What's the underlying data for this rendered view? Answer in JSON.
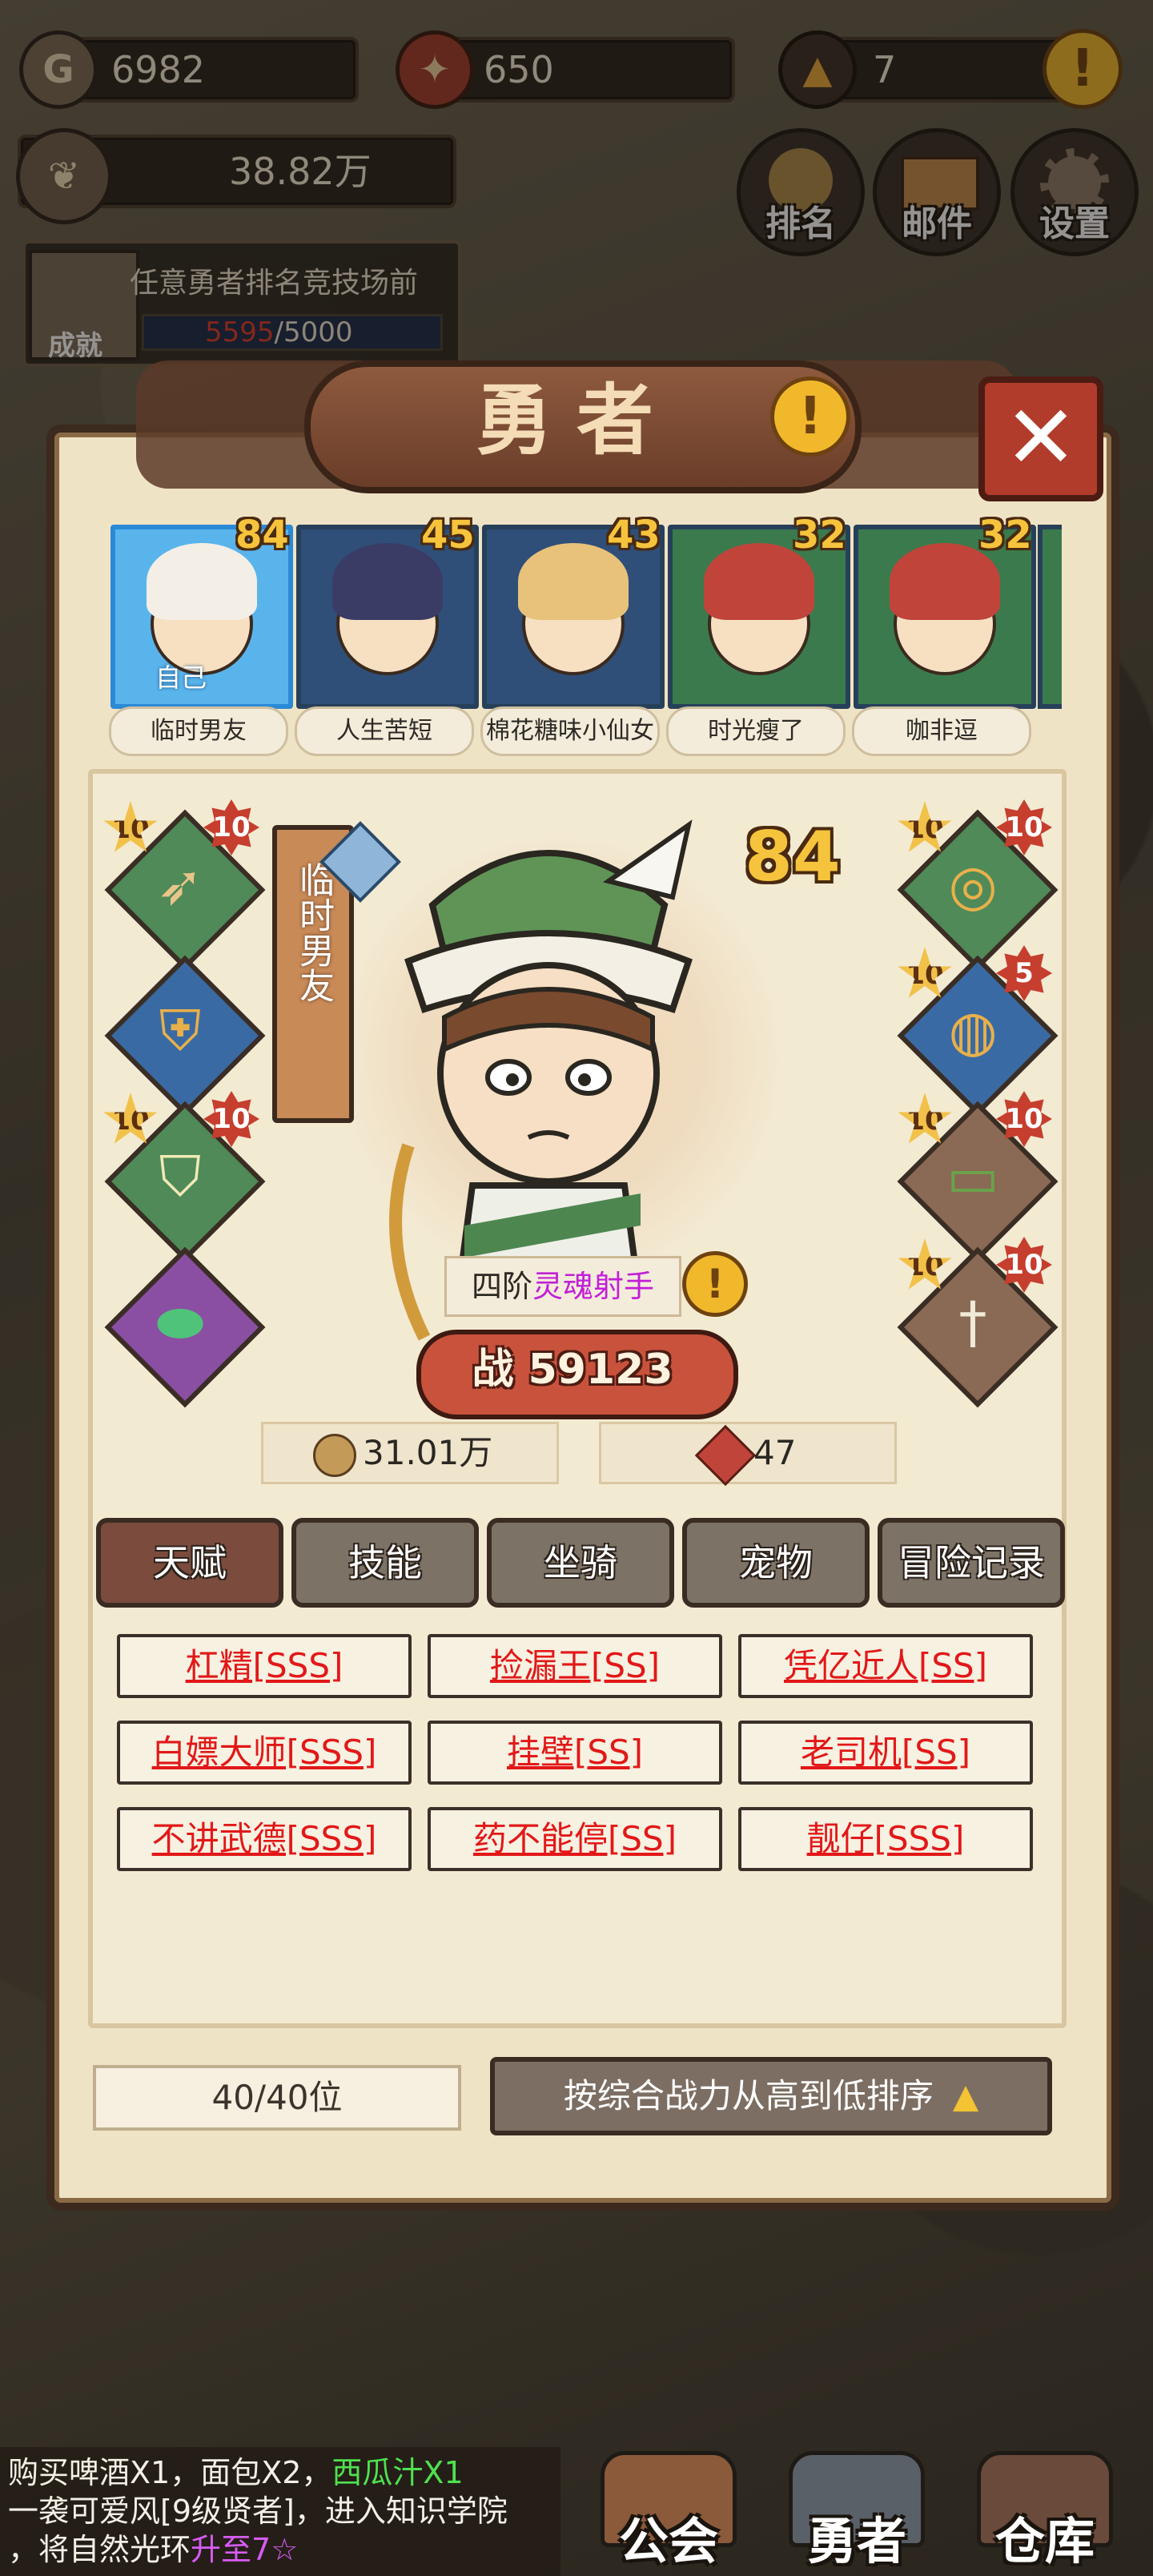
{
  "top_bar": {
    "gold": "6982",
    "gems": "650",
    "tokens": "7",
    "power_total": "38.82万",
    "achievement": {
      "text": "任意勇者排名竞技场前",
      "progress_current": "5595",
      "progress_sep": "/",
      "progress_total": "5000",
      "label": "成就"
    },
    "buttons": {
      "rank": "排名",
      "mail": "邮件",
      "settings": "设置"
    }
  },
  "panel": {
    "title": "勇者",
    "heroes": [
      {
        "name": "临时男友",
        "level": "84",
        "color": "#4aa7e8",
        "hat": "#5e8a4c",
        "tag": "自己"
      },
      {
        "name": "人生苦短",
        "level": "45",
        "color": "#2f4f78",
        "hat": "#3b3c66",
        "tag": ""
      },
      {
        "name": "棉花糖味小仙女",
        "level": "43",
        "color": "#2f4f78",
        "hat": "#e8c27a",
        "tag": ""
      },
      {
        "name": "时光瘦了",
        "level": "32",
        "color": "#3b7a4d",
        "hat": "#c0443a",
        "tag": ""
      },
      {
        "name": "咖非逗",
        "level": "32",
        "color": "#3b7a4d",
        "hat": "#c0443a",
        "tag": ""
      }
    ],
    "selected_hero": {
      "name": "临时男友",
      "level": "84",
      "class_prefix": "四阶",
      "class_name": "灵魂射手",
      "power_label": "战",
      "power": "59123",
      "gold_stat": "31.01万",
      "gem_stat": "47"
    },
    "equipment_left": [
      {
        "icon": "bow-icon",
        "glyph": "➶",
        "star": "10",
        "rank": "10",
        "color": "#4f8a58"
      },
      {
        "icon": "armor-icon",
        "glyph": "🛡",
        "star": "",
        "rank": "",
        "color": "#3a6aa3"
      },
      {
        "icon": "cloak-icon",
        "glyph": "⛉",
        "star": "10",
        "rank": "10",
        "color": "#4f8a58"
      },
      {
        "icon": "boots-icon",
        "glyph": "👢",
        "star": "",
        "rank": "",
        "color": "#8a4fa3"
      }
    ],
    "equipment_right": [
      {
        "icon": "necklace-icon",
        "glyph": "◎",
        "star": "10",
        "rank": "10",
        "color": "#4f8a58"
      },
      {
        "icon": "ring-icon",
        "glyph": "💍",
        "star": "10",
        "rank": "5",
        "color": "#3a6aa3"
      },
      {
        "icon": "belt-icon",
        "glyph": "▭",
        "star": "10",
        "rank": "10",
        "color": "#8a6a55"
      },
      {
        "icon": "dagger-icon",
        "glyph": "🗡",
        "star": "10",
        "rank": "10",
        "color": "#8a6a55"
      }
    ],
    "tabs": [
      "天赋",
      "技能",
      "坐骑",
      "宠物",
      "冒险记录"
    ],
    "talents": [
      "杠精[SSS]",
      "捡漏王[SS]",
      "凭亿近人[SS]",
      "白嫖大师[SSS]",
      "挂壁[SS]",
      "老司机[SS]",
      "不讲武德[SSS]",
      "药不能停[SS]",
      "靓仔[SSS]"
    ],
    "count": "40/40位",
    "sort_label": "按综合战力从高到低排序"
  },
  "chat": {
    "line1": "购买啤酒X1，面包X2，",
    "line1_green": "西瓜汁X1",
    "line2": "一袭可爱风[9级贤者]，进入知识学院",
    "line3": "，将自然光环",
    "line3_purple": "升至7☆"
  },
  "bottom_nav": [
    "公会",
    "勇者",
    "仓库"
  ]
}
